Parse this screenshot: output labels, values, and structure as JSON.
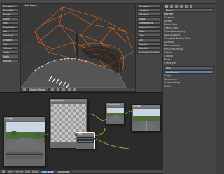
{
  "viewport": {
    "title": "User Persp",
    "mode": "Object Mode",
    "footer_label": "(1) Plane"
  },
  "tool_shelf": {
    "items": [
      "Transform",
      "Translate",
      "Rotate",
      "Scale",
      "Edit",
      "Duplicate",
      "Join",
      "Shading",
      "Smooth",
      "Flat",
      "History",
      "Undo",
      "Redo",
      "Repeat"
    ]
  },
  "n_panel": {
    "sections": [
      "Transform",
      "Location",
      "Rotation",
      "Scale",
      "Dimensions",
      "Grease Pencil",
      "View",
      "Lens",
      "Clip",
      "Display",
      "Shading",
      "Background Images"
    ]
  },
  "properties": {
    "object_name": "Plane",
    "render_label": "Render",
    "sections": [
      "Camera",
      "Image",
      "Resolution",
      "Frame Rate",
      "Time Remapping",
      "Anti-Aliasing",
      "Sampled Motion Blur",
      "Shading",
      "Performance",
      "Post Processing",
      "Stamp",
      "Output",
      "Bake",
      "Freestyle"
    ],
    "output_label": "Output",
    "format_label": "PNG",
    "add_button": "Add Image",
    "checkboxes": [
      "Edge",
      "Sequencer",
      "Compositing",
      "Dither"
    ]
  },
  "node_editor": {
    "footer": [
      "View",
      "Select",
      "Add",
      "Node"
    ],
    "use_nodes": "Use Nodes",
    "backdrop": "Backdrop",
    "nodes": {
      "image": "Image",
      "alpha_over": "Alpha Over",
      "mix": "Mix",
      "composite": "Composite",
      "viewer": "Viewer"
    }
  },
  "colors": {
    "wire_orange": "#ff6a13",
    "selected_blue": "#5580b0",
    "socket_yellow": "#c7c729"
  }
}
